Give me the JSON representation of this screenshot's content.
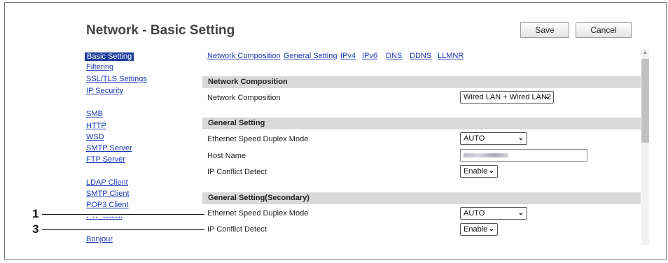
{
  "header": {
    "title": "Network - Basic Setting",
    "save_label": "Save",
    "cancel_label": "Cancel"
  },
  "sidebar": {
    "items": [
      {
        "label": "Basic Setting",
        "active": true
      },
      {
        "label": "Filtering"
      },
      {
        "label": "SSL/TLS Settings"
      },
      {
        "label": "IP Security"
      },
      {
        "label": "SMB"
      },
      {
        "label": "HTTP"
      },
      {
        "label": "WSD"
      },
      {
        "label": "SMTP Server"
      },
      {
        "label": "FTP Server"
      },
      {
        "label": "LDAP Client"
      },
      {
        "label": "SMTP Client"
      },
      {
        "label": "POP3 Client"
      },
      {
        "label": "FTP Client"
      },
      {
        "label": "Bonjour"
      }
    ]
  },
  "top_links": [
    "Network Composition",
    "General Setting",
    "IPv4",
    "IPv6",
    "DNS",
    "DDNS",
    "LLMNR"
  ],
  "sections": {
    "network_composition": {
      "header": "Network Composition",
      "rows": [
        {
          "label": "Network Composition",
          "value": "Wired LAN + Wired LAN2"
        }
      ]
    },
    "general_setting": {
      "header": "General Setting",
      "rows": [
        {
          "label": "Ethernet Speed Duplex Mode",
          "value": "AUTO"
        },
        {
          "label": "Host Name",
          "value": ""
        },
        {
          "label": "IP Conflict Detect",
          "value": "Enable"
        }
      ]
    },
    "general_setting_secondary": {
      "header": "General Setting(Secondary)",
      "rows": [
        {
          "label": "Ethernet Speed Duplex Mode",
          "value": "AUTO"
        },
        {
          "label": "IP Conflict Detect",
          "value": "Enable"
        }
      ]
    }
  },
  "callouts": [
    "1",
    "3"
  ],
  "icons": {
    "dropdown": "chevron-down-icon",
    "scroll_up": "arrow-up-icon"
  },
  "colors": {
    "link": "#1a3bb5",
    "active_bg": "#1d3c9a",
    "section_bg": "#d9d9d9"
  }
}
